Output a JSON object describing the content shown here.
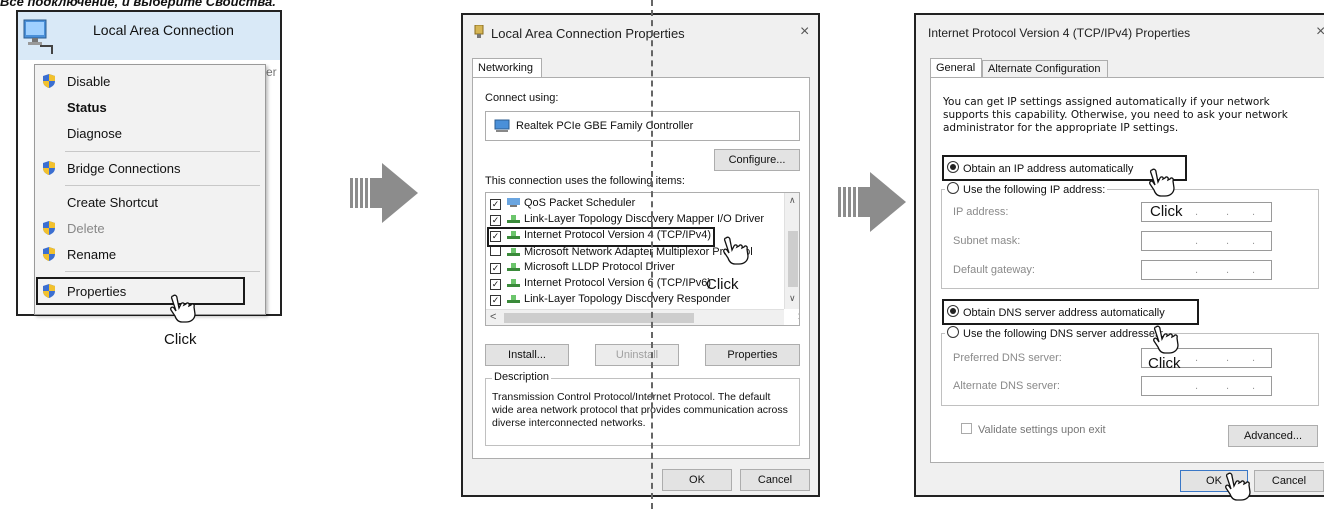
{
  "caption": "Все подключение, и выберите Свойства.",
  "step1": {
    "title": "Local Area Connection",
    "partial_text": "er",
    "menu": [
      {
        "label": "Disable",
        "shield": true,
        "style": "normal"
      },
      {
        "label": "Status",
        "shield": false,
        "style": "bold"
      },
      {
        "label": "Diagnose",
        "shield": false,
        "style": "normal"
      },
      {
        "label": "Bridge Connections",
        "shield": true,
        "style": "normal"
      },
      {
        "label": "Create Shortcut",
        "shield": false,
        "style": "normal"
      },
      {
        "label": "Delete",
        "shield": true,
        "style": "gray"
      },
      {
        "label": "Rename",
        "shield": true,
        "style": "normal"
      },
      {
        "label": "Properties",
        "shield": true,
        "style": "normal"
      }
    ],
    "click_label": "Click"
  },
  "step2": {
    "title": "Local Area Connection Properties",
    "close": "×",
    "tab": "Networking",
    "connect_using": "Connect using:",
    "adapter": "Realtek PCIe GBE Family Controller",
    "configure": "Configure...",
    "items_label": "This connection uses the following items:",
    "items": [
      {
        "label": "QoS Packet Scheduler",
        "checked": true
      },
      {
        "label": "Link-Layer Topology Discovery Mapper I/O Driver",
        "checked": true
      },
      {
        "label": "Internet Protocol Version 4 (TCP/IPv4)",
        "checked": true
      },
      {
        "label": "Microsoft Network Adapter Multiplexor Protocol",
        "checked": false
      },
      {
        "label": "Microsoft LLDP Protocol Driver",
        "checked": true
      },
      {
        "label": "Internet Protocol Version 6 (TCP/IPv6)",
        "checked": true
      },
      {
        "label": "Link-Layer Topology Discovery Responder",
        "checked": true
      }
    ],
    "install": "Install...",
    "uninstall": "Uninstall",
    "properties": "Properties",
    "description_title": "Description",
    "description": "Transmission Control Protocol/Internet Protocol. The default wide area network protocol that provides communication across diverse interconnected networks.",
    "ok": "OK",
    "cancel": "Cancel",
    "click_label": "Click"
  },
  "step3": {
    "title": "Internet Protocol Version 4 (TCP/IPv4) Properties",
    "close": "×",
    "tabs": [
      "General",
      "Alternate Configuration"
    ],
    "intro": "You can get IP settings assigned automatically if your network supports this capability. Otherwise, you need to ask your network administrator for the appropriate IP settings.",
    "obtain_ip": "Obtain an IP address automatically",
    "use_ip": "Use the following IP address:",
    "ip_address": "IP address:",
    "subnet_mask": "Subnet mask:",
    "default_gateway": "Default gateway:",
    "obtain_dns": "Obtain DNS server address automatically",
    "use_dns": "Use the following DNS server addresses:",
    "preferred_dns": "Preferred DNS server:",
    "alternate_dns": "Alternate DNS server:",
    "validate": "Validate settings upon exit",
    "advanced": "Advanced...",
    "ok": "OK",
    "cancel": "Cancel",
    "click_label": "Click"
  }
}
